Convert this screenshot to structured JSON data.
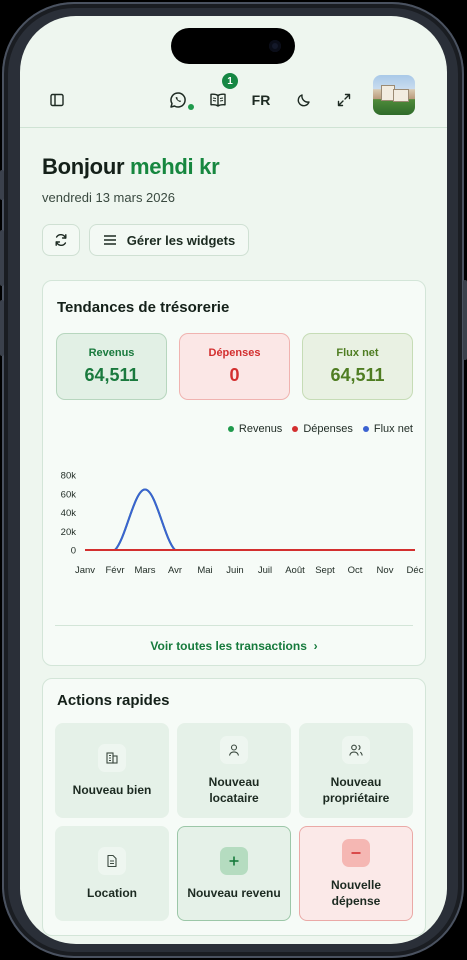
{
  "header": {
    "language": "FR",
    "notification_count": "1"
  },
  "greeting": {
    "hello": "Bonjour",
    "name": "mehdi kr",
    "date": "vendredi 13 mars 2026"
  },
  "toolbar": {
    "manage_widgets": "Gérer les widgets"
  },
  "treasury": {
    "title": "Tendances de trésorerie",
    "stats": [
      {
        "label": "Revenus",
        "value": "64,511",
        "color": "#1a7a3e",
        "bg": "#e2f0e5",
        "border": "#b7d6be"
      },
      {
        "label": "Dépenses",
        "value": "0",
        "color": "#d32f2f",
        "bg": "#fbe7e6",
        "border": "#f0b3b0"
      },
      {
        "label": "Flux net",
        "value": "64,511",
        "color": "#4f7d22",
        "bg": "#e9f1e3",
        "border": "#c6dcb6"
      }
    ],
    "legend": [
      {
        "label": "Revenus",
        "color": "#1f9a4c"
      },
      {
        "label": "Dépenses",
        "color": "#d32f2f"
      },
      {
        "label": "Flux net",
        "color": "#3b62d1"
      }
    ],
    "view_all": "Voir toutes les transactions"
  },
  "chart_data": {
    "type": "line",
    "categories": [
      "Janv",
      "Févr",
      "Mars",
      "Avr",
      "Mai",
      "Juin",
      "Juil",
      "Août",
      "Sept",
      "Oct",
      "Nov",
      "Déc"
    ],
    "yticks": [
      "80k",
      "60k",
      "40k",
      "20k",
      "0"
    ],
    "ylim": [
      0,
      80000
    ],
    "series": [
      {
        "name": "Revenus",
        "color": "#1f9a4c",
        "values": [
          0,
          0,
          64511,
          0,
          0,
          0,
          0,
          0,
          0,
          0,
          0,
          0
        ]
      },
      {
        "name": "Dépenses",
        "color": "#d32f2f",
        "values": [
          0,
          0,
          0,
          0,
          0,
          0,
          0,
          0,
          0,
          0,
          0,
          0
        ]
      },
      {
        "name": "Flux net",
        "color": "#3b62d1",
        "values": [
          0,
          0,
          64511,
          0,
          0,
          0,
          0,
          0,
          0,
          0,
          0,
          0
        ]
      }
    ]
  },
  "quick_actions": {
    "title": "Actions rapides",
    "items": [
      {
        "label": "Nouveau bien",
        "icon": "building-icon"
      },
      {
        "label": "Nouveau locataire",
        "icon": "user-icon"
      },
      {
        "label": "Nouveau propriétaire",
        "icon": "users-icon"
      },
      {
        "label": "Location",
        "icon": "document-icon"
      },
      {
        "label": "Nouveau revenu",
        "icon": "plus-icon"
      },
      {
        "label": "Nouvelle dépense",
        "icon": "minus-icon"
      }
    ]
  }
}
